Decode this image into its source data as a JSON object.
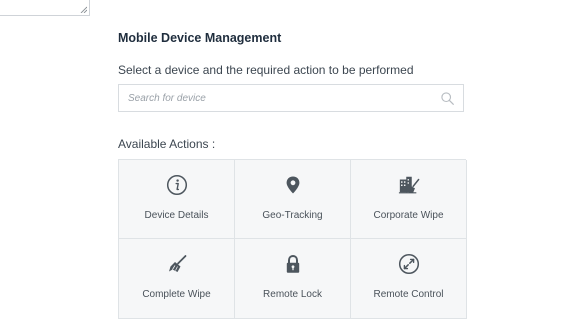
{
  "panel": {
    "title": "Mobile Device Management",
    "subtitle": "Select a device and the required action to be performed",
    "search": {
      "placeholder": "Search for device",
      "value": ""
    },
    "actions_label": "Available Actions :"
  },
  "actions": [
    {
      "label": "Device Details",
      "icon": "info-icon"
    },
    {
      "label": "Geo-Tracking",
      "icon": "map-pin-icon"
    },
    {
      "label": "Corporate Wipe",
      "icon": "corporate-wipe-icon"
    },
    {
      "label": "Complete Wipe",
      "icon": "broom-icon"
    },
    {
      "label": "Remote Lock",
      "icon": "lock-icon"
    },
    {
      "label": "Remote Control",
      "icon": "remote-control-icon"
    }
  ],
  "colors": {
    "icon": "#4d565e",
    "tile_background": "#f6f7f8",
    "border": "#dfe3e6",
    "title": "#1f2d3d"
  }
}
